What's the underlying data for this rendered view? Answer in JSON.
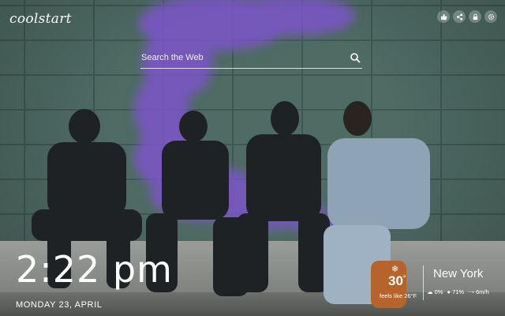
{
  "brand": {
    "logo": "coolstart"
  },
  "toolbar": {
    "icons": [
      "thumbs-up-icon",
      "share-icon",
      "lock-icon",
      "settings-icon"
    ]
  },
  "search": {
    "placeholder": "Search the Web",
    "value": ""
  },
  "clock": {
    "time": "2:22 pm",
    "date": "MONDAY 23, APRIL"
  },
  "weather": {
    "icon": "snowflake-icon",
    "temperature": "30",
    "unit": "°",
    "feels_like": "feels like 26°F",
    "city": "New York",
    "cloud": "0%",
    "humidity": "71%",
    "wind": "6m/h"
  },
  "colors": {
    "smoke": "#7b55c9",
    "wall": "#4e6b64"
  }
}
